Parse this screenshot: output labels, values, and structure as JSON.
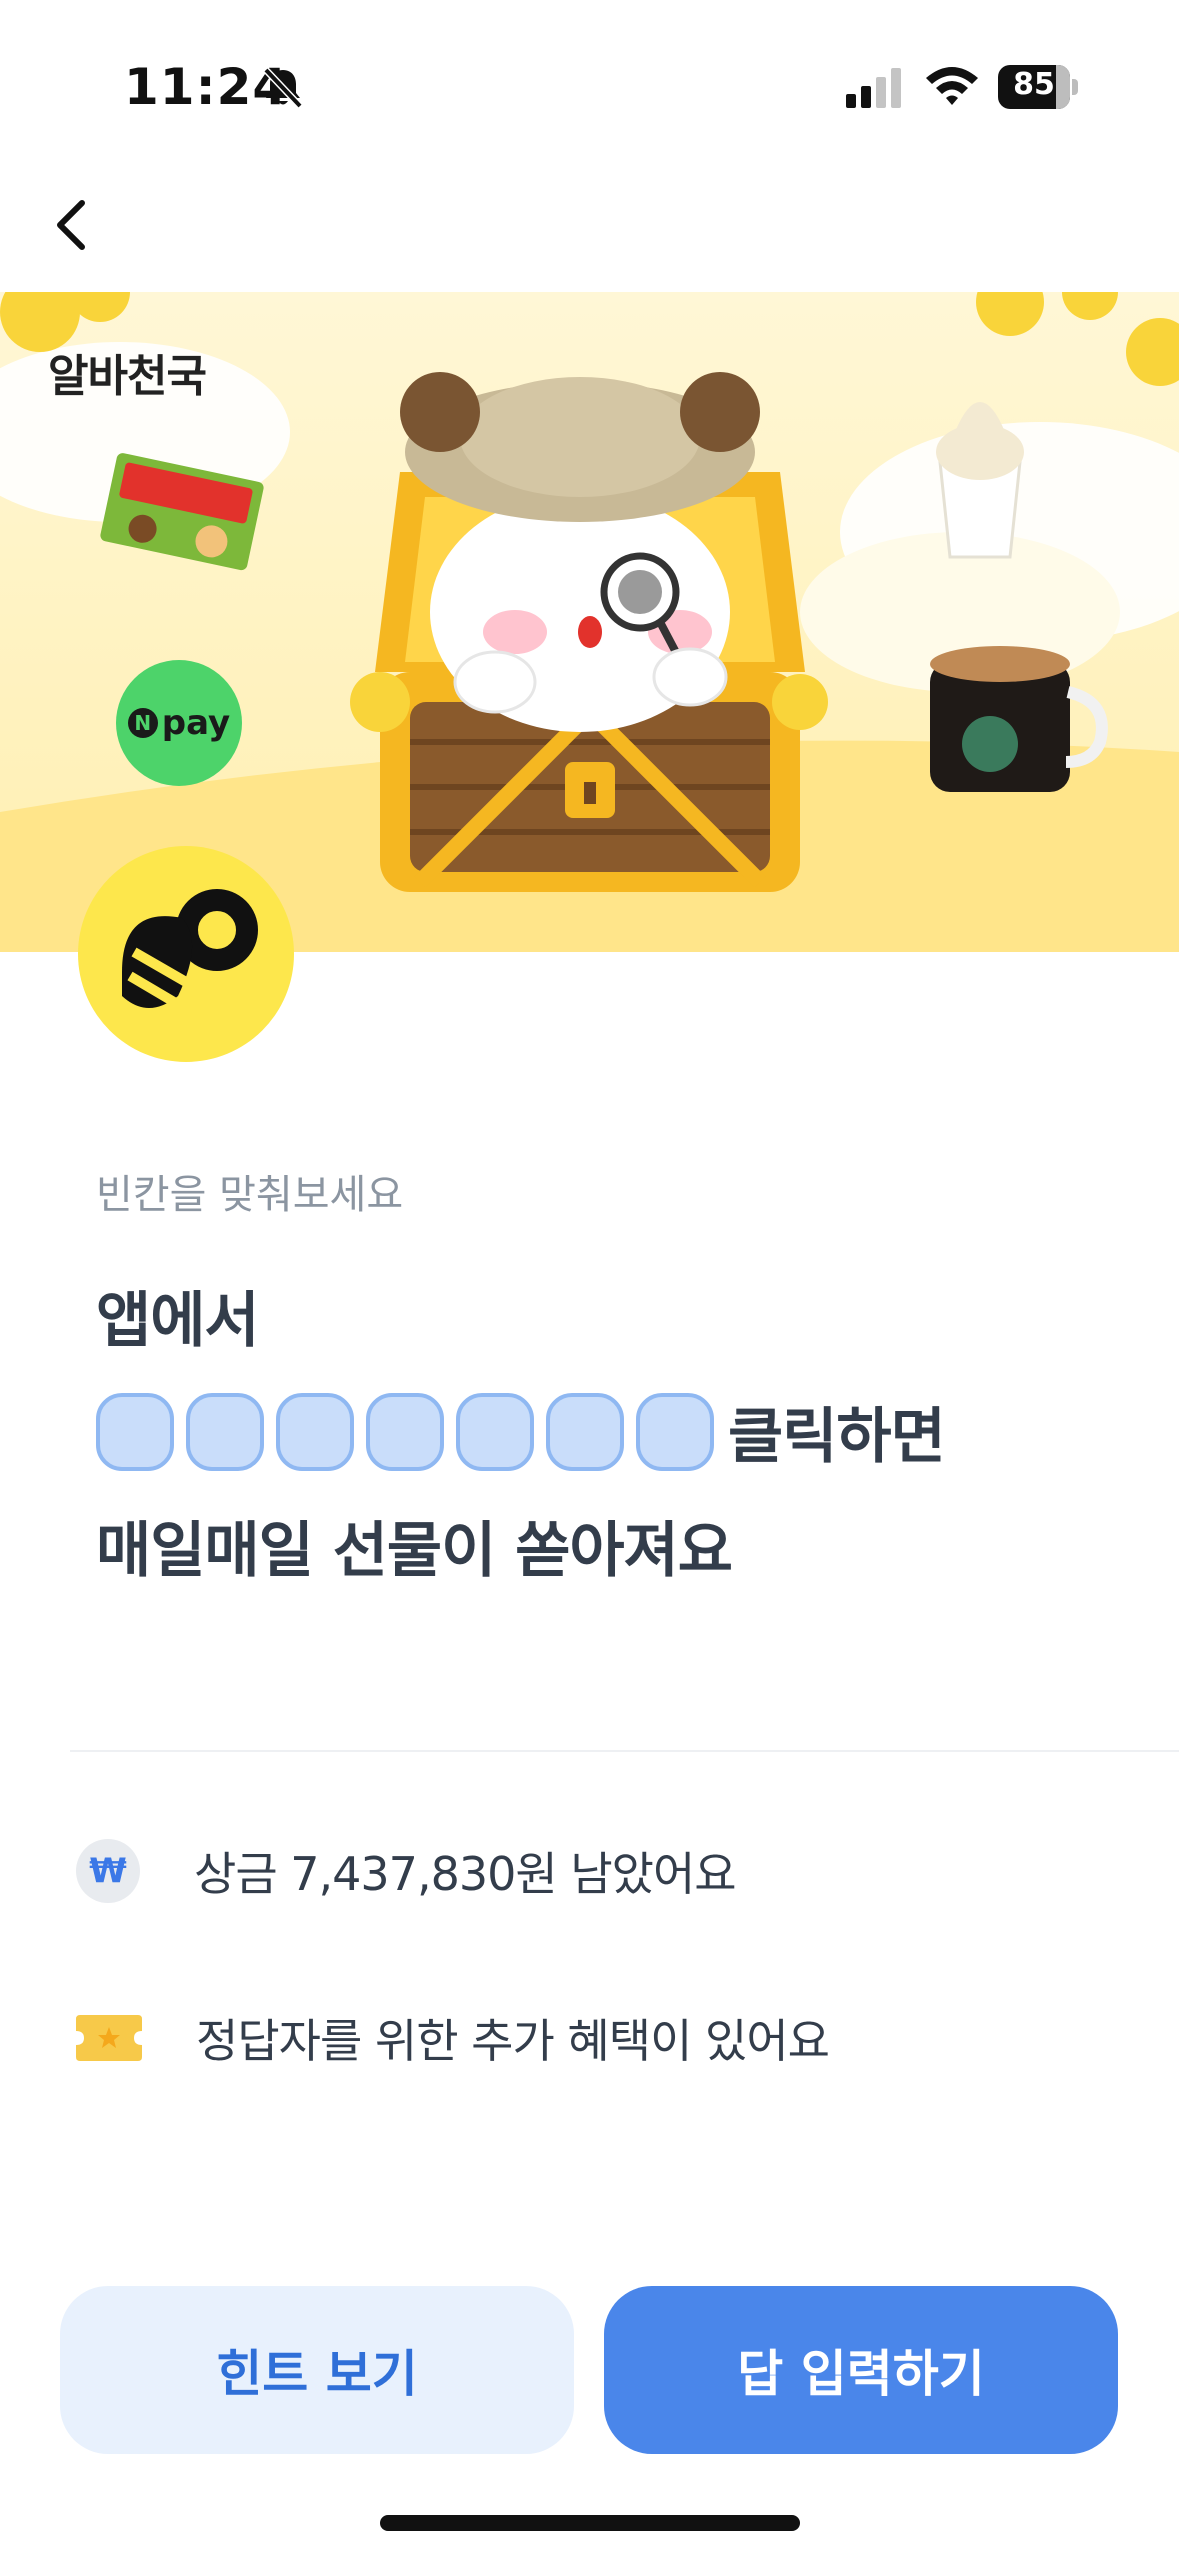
{
  "status_bar": {
    "time": "11:24",
    "battery": "85",
    "icons": [
      "bell-off-icon",
      "signal-icon",
      "wifi-icon",
      "battery-icon"
    ]
  },
  "nav": {
    "back_icon": "chevron-left-icon"
  },
  "banner": {
    "brand": "알바천국",
    "npay": "pay",
    "npay_n": "N"
  },
  "quiz": {
    "hint_label": "빈칸을 맞춰보세요",
    "line1": "앱에서",
    "blank_count": 7,
    "line2_suffix": "클릭하면",
    "line3": "매일매일 선물이 쏟아져요"
  },
  "info": {
    "prize_icon": "₩",
    "prize_text": "상금 7,437,830원 남았어요",
    "benefit_text": "정답자를 위한 추가 혜택이 있어요"
  },
  "buttons": {
    "hint": "힌트 보기",
    "answer": "답 입력하기"
  },
  "colors": {
    "accent": "#4a86ea",
    "accent_light": "#e8f1fd",
    "blank_fill": "#c9ddfa",
    "bee_yellow": "#fde74c",
    "npay_green": "#4dd36a"
  }
}
